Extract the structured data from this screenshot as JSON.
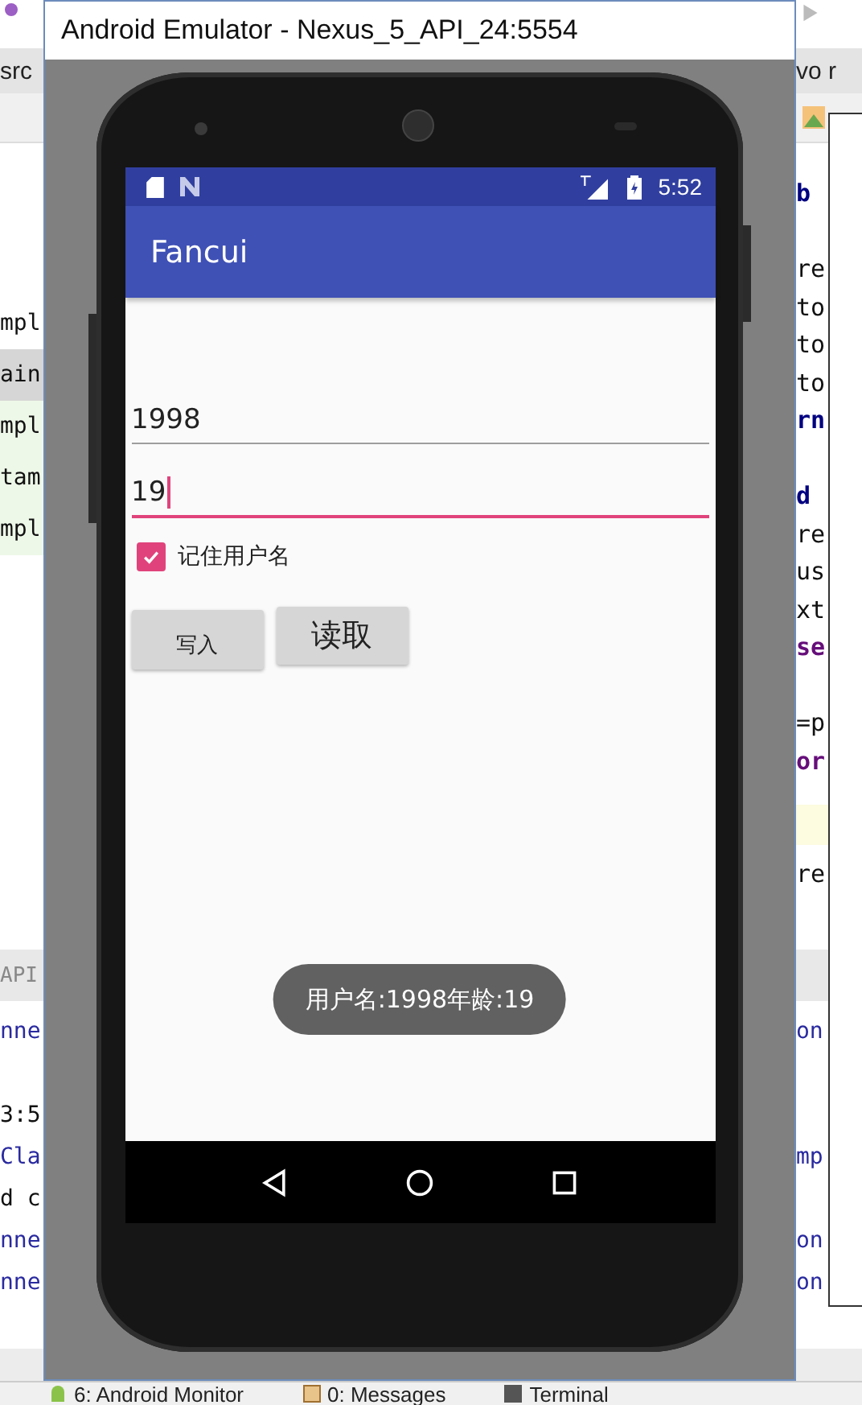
{
  "ide": {
    "top_left_tab": "src",
    "top_right_tab": "vo r",
    "left_lines": [
      {
        "text": "mpl",
        "kind": "plain"
      },
      {
        "text": "ain",
        "kind": "selected"
      },
      {
        "text": "mpl",
        "kind": "modified"
      },
      {
        "text": "tam",
        "kind": "modified"
      },
      {
        "text": "mpl",
        "kind": "modified"
      }
    ],
    "right_lines": [
      {
        "text": "b",
        "kind": "type"
      },
      {
        "text": "re",
        "kind": "plain"
      },
      {
        "text": "to",
        "kind": "plain"
      },
      {
        "text": "to",
        "kind": "plain"
      },
      {
        "text": "to",
        "kind": "plain"
      },
      {
        "text": "rn",
        "kind": "type"
      },
      {
        "text": "d",
        "kind": "type"
      },
      {
        "text": "re",
        "kind": "plain"
      },
      {
        "text": "us",
        "kind": "plain"
      },
      {
        "text": "xt",
        "kind": "plain"
      },
      {
        "text": "se",
        "kind": "keyword"
      },
      {
        "text": "=p",
        "kind": "plain"
      },
      {
        "text": "or",
        "kind": "keyword"
      },
      {
        "text": "re",
        "kind": "plain"
      }
    ],
    "console_tab": "API",
    "console_left": [
      {
        "text": "nne",
        "kind": "link"
      },
      {
        "text": "3:5",
        "kind": "plain"
      },
      {
        "text": "Cla",
        "kind": "link"
      },
      {
        "text": "d c",
        "kind": "plain"
      },
      {
        "text": "nne",
        "kind": "link"
      },
      {
        "text": "nne",
        "kind": "link"
      }
    ],
    "console_right": [
      {
        "text": "on",
        "kind": "link"
      },
      {
        "text": "mp",
        "kind": "link"
      },
      {
        "text": "on",
        "kind": "link"
      },
      {
        "text": "on",
        "kind": "link"
      }
    ],
    "bottom_tabs": [
      {
        "label": "6: Android Monitor",
        "kind": "android"
      },
      {
        "label": "0: Messages",
        "kind": "messages"
      },
      {
        "label": "Terminal",
        "kind": "terminal"
      }
    ]
  },
  "emulator": {
    "title": "Android Emulator - Nexus_5_API_24:5554",
    "status_bar": {
      "time": "5:52"
    },
    "app_bar": {
      "title": "Fancui"
    },
    "fields": [
      {
        "value": "1998",
        "focused": false
      },
      {
        "value": "19",
        "focused": true
      }
    ],
    "checkbox": {
      "label": "记住用户名",
      "checked": true
    },
    "buttons": [
      {
        "label": "写入",
        "kind": "small"
      },
      {
        "label": "读取",
        "kind": "large"
      }
    ],
    "toast": "用户名:1998年龄:19"
  }
}
